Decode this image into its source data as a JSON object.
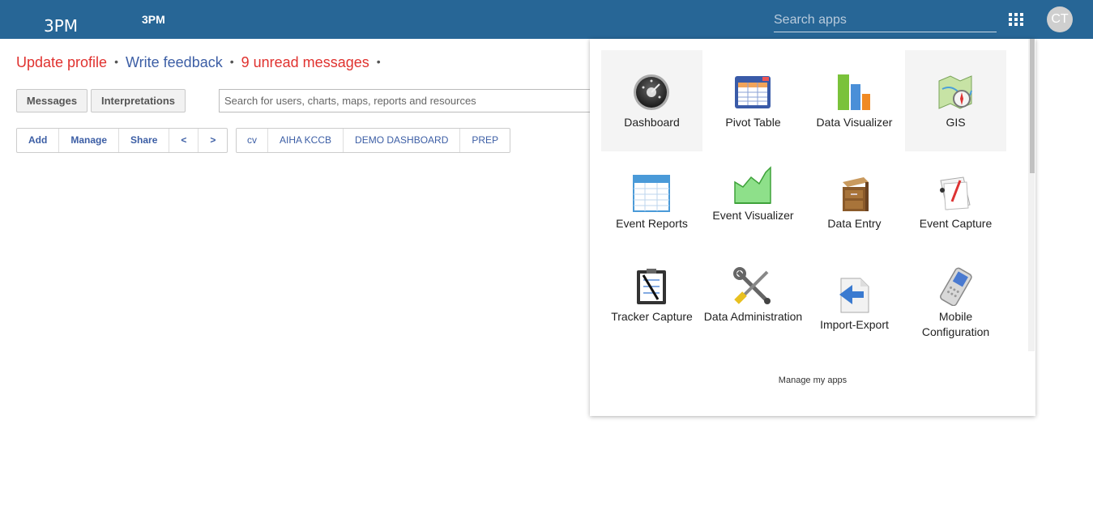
{
  "header": {
    "logo_text": "3PM",
    "title": "3PM",
    "search_placeholder": "Search apps",
    "avatar_initials": "CT",
    "bg_color": "#276696"
  },
  "messages_line": {
    "update_profile": "Update profile",
    "write_feedback": "Write feedback",
    "unread_messages": "9 unread messages",
    "bullet": "•"
  },
  "interpretation_buttons": {
    "messages": "Messages",
    "interpretations": "Interpretations"
  },
  "main_search": {
    "placeholder": "Search for users, charts, maps, reports and resources"
  },
  "dashboard_toolbar": {
    "add": "Add",
    "manage": "Manage",
    "share": "Share",
    "prev": "<",
    "next": ">",
    "dashboards": [
      "cv",
      "AIHA KCCB",
      "DEMO DASHBOARD",
      "PREP"
    ]
  },
  "apps_menu": {
    "apps": [
      {
        "label": "Dashboard",
        "icon": "dashboard-icon"
      },
      {
        "label": "Pivot Table",
        "icon": "pivot-table-icon"
      },
      {
        "label": "Data Visualizer",
        "icon": "data-visualizer-icon"
      },
      {
        "label": "GIS",
        "icon": "gis-map-icon"
      },
      {
        "label": "Event Reports",
        "icon": "event-reports-icon"
      },
      {
        "label": "Event Visualizer",
        "icon": "event-visualizer-icon"
      },
      {
        "label": "Data Entry",
        "icon": "data-entry-icon"
      },
      {
        "label": "Event Capture",
        "icon": "event-capture-icon"
      },
      {
        "label": "Tracker Capture",
        "icon": "tracker-capture-icon"
      },
      {
        "label": "Data Administration",
        "icon": "data-administration-icon"
      },
      {
        "label": "Import-Export",
        "icon": "import-export-icon"
      },
      {
        "label": "Mobile Configuration",
        "icon": "mobile-configuration-icon"
      }
    ],
    "manage_link": "Manage my apps"
  },
  "colors": {
    "link_red": "#e0322f",
    "link_blue": "#3c5ea5"
  }
}
